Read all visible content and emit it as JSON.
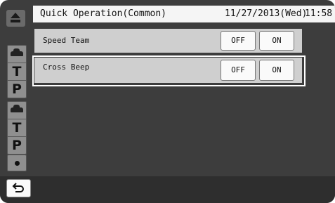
{
  "header": {
    "title": "Quick Operation(Common)",
    "date": "11/27/2013(Wed)",
    "time": "11:58"
  },
  "sidebar": {
    "top_icon": "eject-icon",
    "group1": {
      "icon": "car-icon",
      "items": [
        "T",
        "P"
      ]
    },
    "group2": {
      "icon": "car-icon",
      "items": [
        "T",
        "P"
      ]
    },
    "bottom_icon": "dot-icon"
  },
  "settings": [
    {
      "label": "Speed Team",
      "off_label": "OFF",
      "on_label": "ON"
    },
    {
      "label": "Cross Beep",
      "off_label": "OFF",
      "on_label": "ON",
      "selected": true
    }
  ],
  "footer": {
    "back_icon": "back-arrow-icon"
  },
  "colors": {
    "background": "#3d3d3d",
    "titlebar": "#f5f5f5",
    "row": "#cfcfcf",
    "highlight": "#ffffff"
  }
}
